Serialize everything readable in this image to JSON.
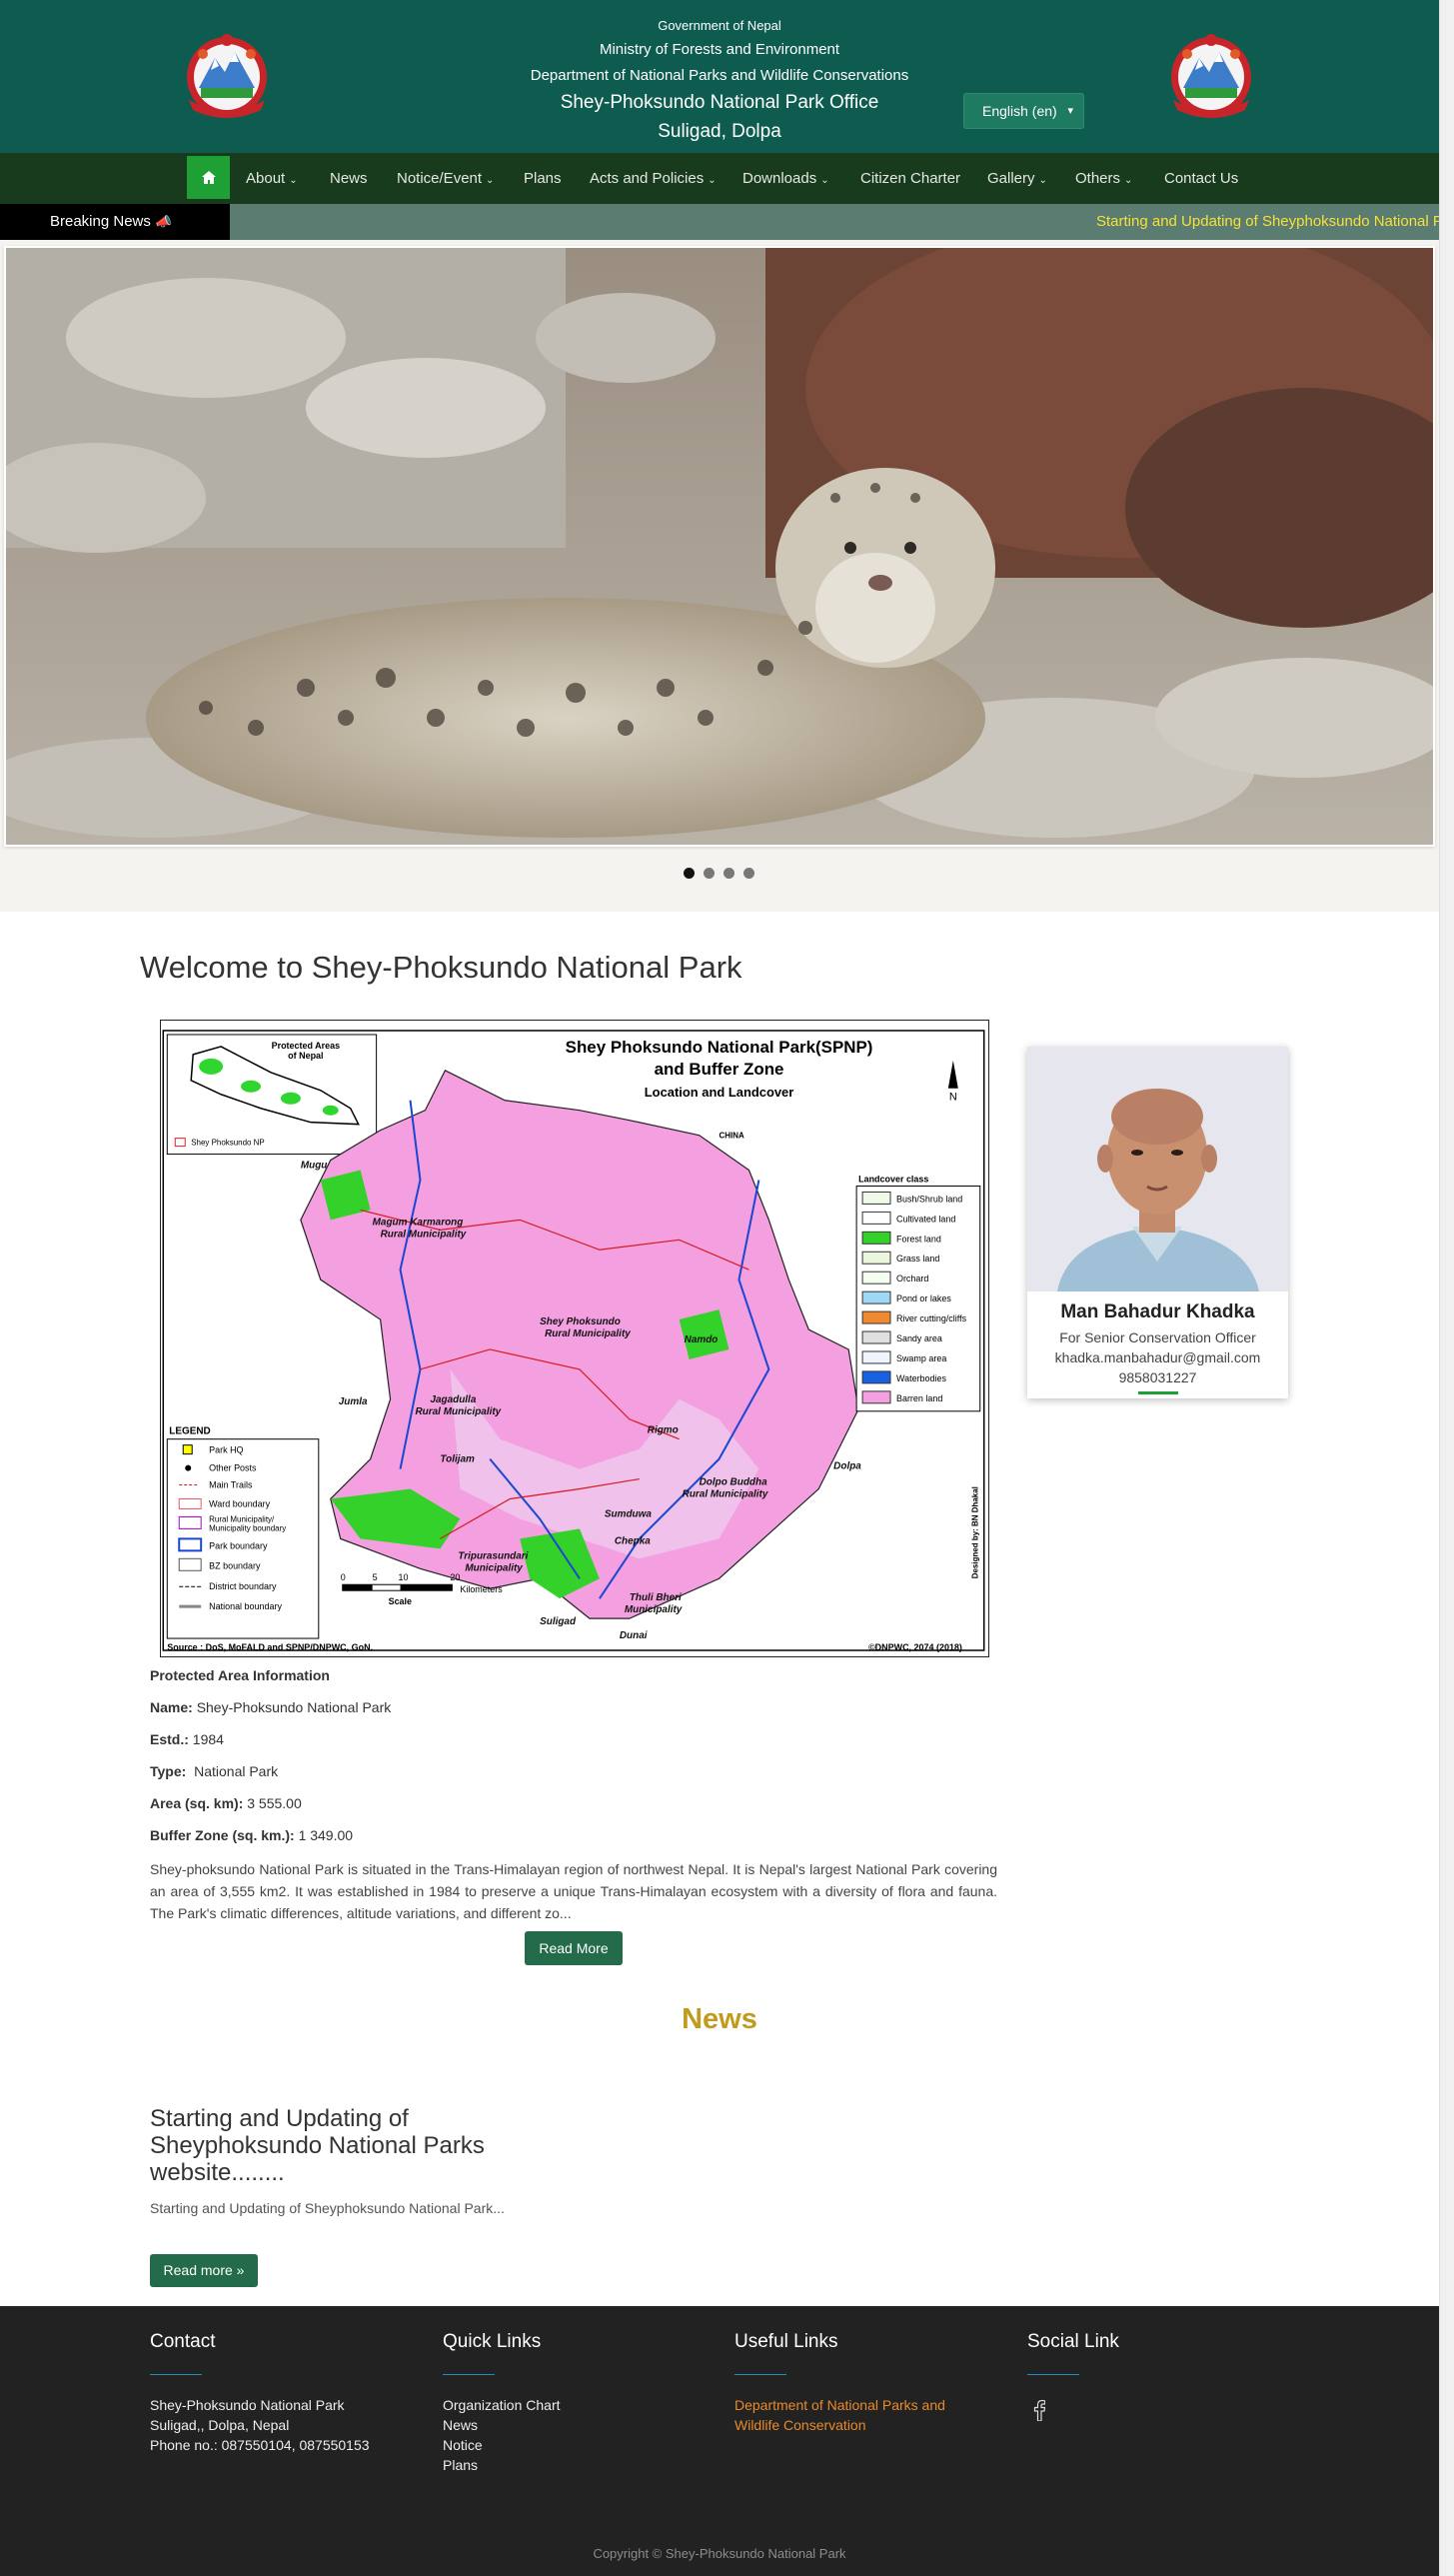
{
  "header": {
    "gov_line1": "Government of Nepal",
    "gov_line2": "Ministry of Forests and Environment",
    "gov_line3": "Department of National Parks and Wildlife Conservations",
    "office_line": "Shey-Phoksundo National Park Office",
    "location_line": "Suligad, Dolpa",
    "language_selected": "English (en)",
    "emblem_icon": "nepal-emblem-icon",
    "bg_color": "#0e5b4f"
  },
  "nav": {
    "home_icon": "home-icon",
    "items": [
      {
        "label": "About",
        "dropdown": true
      },
      {
        "label": "News",
        "dropdown": false
      },
      {
        "label": "Notice/Event",
        "dropdown": true
      },
      {
        "label": "Plans",
        "dropdown": false
      },
      {
        "label": "Acts and Policies",
        "dropdown": true
      },
      {
        "label": "Downloads",
        "dropdown": true
      },
      {
        "label": "Citizen Charter",
        "dropdown": false
      },
      {
        "label": "Gallery",
        "dropdown": true
      },
      {
        "label": "Others",
        "dropdown": true
      },
      {
        "label": "Contact Us",
        "dropdown": false
      }
    ],
    "bg_color": "#173b1c",
    "home_color": "#1fa035"
  },
  "breaking_news": {
    "label": "Breaking News",
    "icon": "bullhorn-icon",
    "text": "Starting and Updating of Sheyphoksundo National Parks website........",
    "text_color": "#f5e13a"
  },
  "slider": {
    "image": "snow-leopard-photo",
    "slides": 4,
    "active": 1
  },
  "welcome": {
    "title": "Welcome to Shey-Phoksundo National Park"
  },
  "map": {
    "title1": "Shey Phoksundo National Park(SPNP)",
    "title2": "and Buffer Zone",
    "subtitle": "Location and Landcover",
    "inset_title": "Protected Areas\nof Nepal",
    "inset_legend": "Shey Phoksundo NP",
    "north": "N",
    "china": "CHINA",
    "place_labels": [
      "Mugu",
      "Magum Karmarong\nRural Municipality",
      "Shey Phoksundo\nRural Municipality",
      "Namdo",
      "Jumla",
      "Jagadulla\nRural Municipality",
      "Rigmo",
      "Tolijam",
      "Dolpo Buddha\nRural Municipality",
      "Sumduwa",
      "Chepka",
      "Tripurasundari\nMunicipality",
      "Thuli Bheri\nMunicipality",
      "Suligad",
      "Dunai",
      "Dolpa"
    ],
    "landcover_title": "Landcover class",
    "landcover": [
      "Bush/Shrub land",
      "Cultivated land",
      "Forest land",
      "Grass land",
      "Orchard",
      "Pond or lakes",
      "River cutting/cliffs",
      "Sandy area",
      "Swamp area",
      "Waterbodies",
      "Barren land"
    ],
    "legend_title": "LEGEND",
    "legend": [
      "Park HQ",
      "Other Posts",
      "Main Trails",
      "Ward boundary",
      "Rural Municipality/\nMunicipality boundary",
      "Park boundary",
      "BZ boundary",
      "District boundary",
      "National boundary"
    ],
    "scale_ticks": [
      "0",
      "5",
      "10",
      "20"
    ],
    "scale_unit": "Kilometers",
    "scale_label": "Scale",
    "source": "Source : DoS, MoFALD and SPNP/DNPWC, GoN.",
    "copyright": "©DNPWC, 2074 (2018)",
    "designer": "Designed by: BN Dhakal"
  },
  "pa_info": {
    "heading": "Protected Area Information",
    "name_label": "Name:",
    "name_value": "Shey-Phoksundo National Park",
    "estd_label": "Estd.:",
    "estd_value": "1984",
    "type_label": "Type:",
    "type_value": "National Park",
    "area_label": "Area (sq. km):",
    "area_value": "3 555.00",
    "buffer_label": "Buffer Zone (sq. km.):",
    "buffer_value": "1 349.00",
    "description": "Shey-phoksundo National Park is situated in the Trans-Himalayan region of northwest Nepal. It is Nepal's largest National Park covering an area of 3,555 km2. It was established in 1984 to preserve a unique Trans-Himalayan ecosystem with a diversity of flora and fauna. The Park's climatic differences, altitude variations, and different zo...",
    "read_more": "Read More"
  },
  "officer": {
    "name": "Man Bahadur Khadka",
    "role": "For Senior Conservation Officer",
    "email": "khadka.manbahadur@gmail.com",
    "phone": "9858031227",
    "photo": "officer-portrait-photo"
  },
  "news": {
    "heading": "News",
    "heading_color": "#c09b1d",
    "item_title": "Starting and Updating of Sheyphoksundo National Parks website........",
    "item_excerpt": "Starting and Updating of Sheyphoksundo National Park...",
    "read_more": "Read more »"
  },
  "footer": {
    "contact_title": "Contact",
    "contact_lines": [
      "Shey-Phoksundo National Park",
      "Suligad,, Dolpa, Nepal",
      "Phone no.: 087550104, 087550153"
    ],
    "quick_title": "Quick Links",
    "quick_links": [
      "Organization Chart",
      "News",
      "Notice",
      "Plans"
    ],
    "useful_title": "Useful Links",
    "useful_links": [
      "Department of National Parks and Wildlife Conservation"
    ],
    "social_title": "Social Link",
    "social_icon": "facebook-icon",
    "copyright": "Copyright © Shey-Phoksundo National Park",
    "bg_color": "#222222"
  }
}
